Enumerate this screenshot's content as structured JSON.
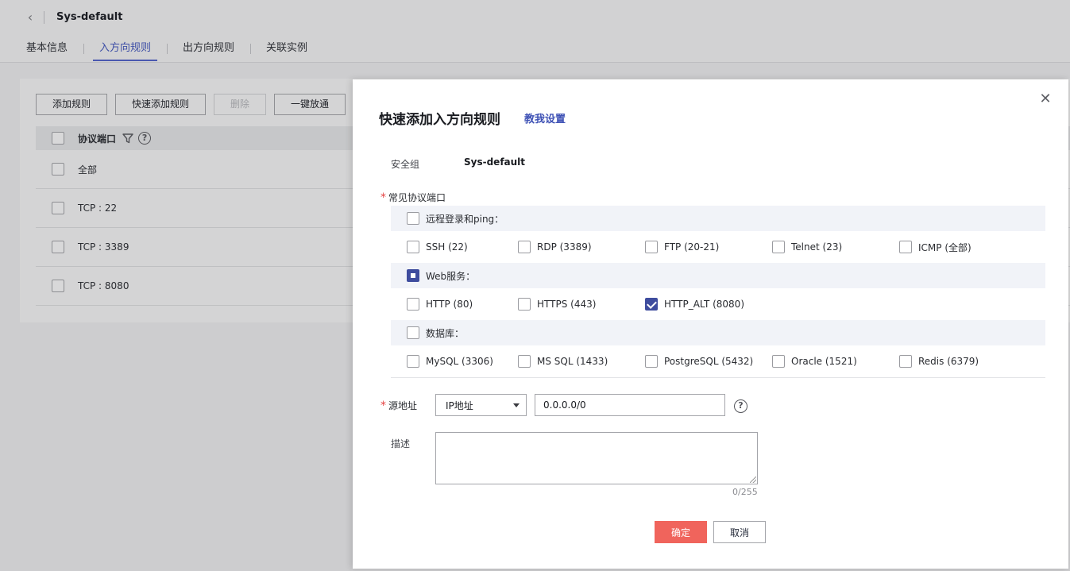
{
  "header": {
    "title": "Sys-default",
    "tabs": [
      {
        "label": "基本信息"
      },
      {
        "label": "入方向规则"
      },
      {
        "label": "出方向规则"
      },
      {
        "label": "关联实例"
      }
    ]
  },
  "toolbar": {
    "add_rule": "添加规则",
    "quick_add_rule": "快速添加规则",
    "delete": "删除",
    "allow_all": "一键放通"
  },
  "table": {
    "header": "协议端口",
    "rows": [
      "全部",
      "TCP : 22",
      "TCP : 3389",
      "TCP : 8080"
    ]
  },
  "drawer": {
    "title": "快速添加入方向规则",
    "help_link": "教我设置",
    "security_group_label": "安全组",
    "security_group_value": "Sys-default",
    "ports_label": "常见协议端口",
    "required_mark": "*",
    "groups": [
      {
        "label": "远程登录和ping：",
        "state": "unchecked",
        "items": [
          {
            "label": "SSH (22)",
            "checked": false
          },
          {
            "label": "RDP (3389)",
            "checked": false
          },
          {
            "label": "FTP (20-21)",
            "checked": false
          },
          {
            "label": "Telnet (23)",
            "checked": false
          },
          {
            "label": "ICMP (全部)",
            "checked": false
          }
        ]
      },
      {
        "label": "Web服务：",
        "state": "partial",
        "items": [
          {
            "label": "HTTP (80)",
            "checked": false
          },
          {
            "label": "HTTPS (443)",
            "checked": false
          },
          {
            "label": "HTTP_ALT (8080)",
            "checked": true
          }
        ]
      },
      {
        "label": "数据库：",
        "state": "unchecked",
        "items": [
          {
            "label": "MySQL (3306)",
            "checked": false
          },
          {
            "label": "MS SQL (1433)",
            "checked": false
          },
          {
            "label": "PostgreSQL (5432)",
            "checked": false
          },
          {
            "label": "Oracle (1521)",
            "checked": false
          },
          {
            "label": "Redis (6379)",
            "checked": false
          }
        ]
      }
    ],
    "source_label": "源地址",
    "source_type": "IP地址",
    "source_value": "0.0.0.0/0",
    "description_label": "描述",
    "description_value": "",
    "counter": "0/255",
    "ok_label": "确定",
    "cancel_label": "取消"
  },
  "colors": {
    "accent": "#3e4c9e",
    "primary_button": "#f0645c",
    "required": "#e54545"
  }
}
